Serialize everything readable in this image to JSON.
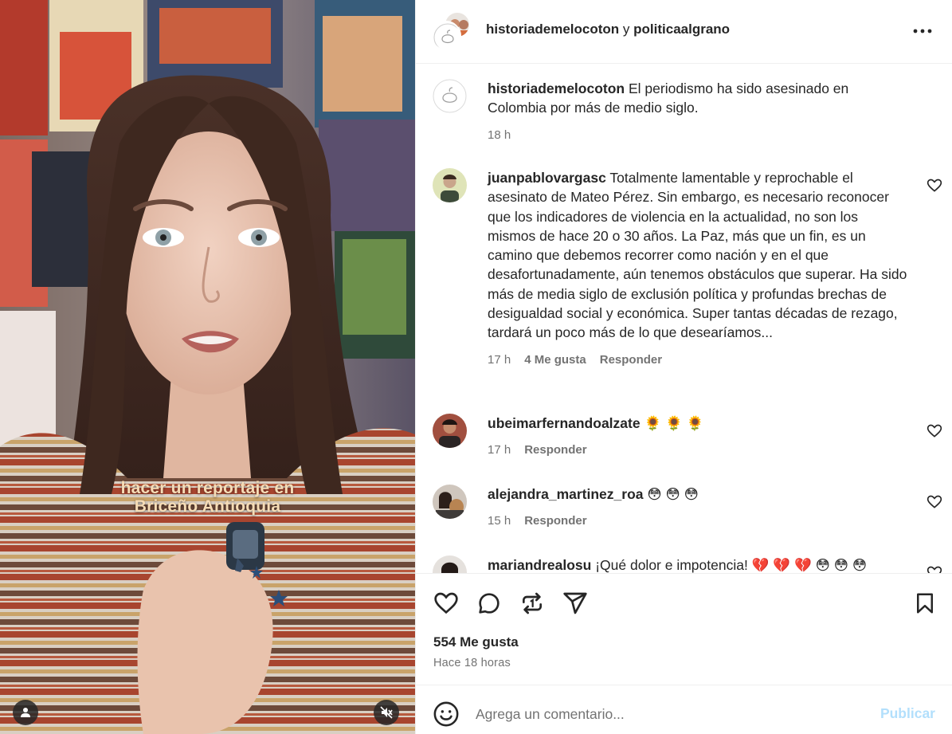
{
  "media": {
    "overlay_line1": "hacer un reportaje en",
    "overlay_line2": "Briceño Antioquia",
    "user_icon": "user-icon",
    "mute_icon": "speaker-muted-icon"
  },
  "header": {
    "author1": "historiademelocoton",
    "joiner": "y",
    "author2": "politicaalgrano",
    "more_icon": "more-horizontal-icon"
  },
  "caption": {
    "user": "historiademelocoton",
    "text": "El periodismo ha sido asesinado en Colombia por más de medio siglo.",
    "time": "18 h"
  },
  "comments": [
    {
      "user": "juanpablovargasc",
      "text": "Totalmente lamentable y reprochable el asesinato de Mateo Pérez. Sin embargo, es necesario reconocer que los indicadores de violencia en la actualidad, no son los mismos de hace 20 o 30 años. La Paz, más que un fin, es un camino que debemos recorrer como nación y en el que desafortunadamente, aún tenemos obstáculos que superar. Ha sido más de media siglo de exclusión política y profundas brechas de desigualdad social y económica. Super tantas décadas de rezago, tardará un poco más de lo que desearíamos...",
      "time": "17 h",
      "likes": "4 Me gusta",
      "reply": "Responder"
    },
    {
      "user": "ubeimarfernandoalzate",
      "text": "🌻 🌻 🌻",
      "time": "17 h",
      "reply": "Responder"
    },
    {
      "user": "alejandra_martinez_roa",
      "text": "😳 😳 😳",
      "time": "15 h",
      "reply": "Responder"
    },
    {
      "user": "mariandrealosu",
      "text": "¡Qué dolor e impotencia!  💔 💔 💔 😳 😳 😳"
    }
  ],
  "actions": {
    "like_icon": "heart-icon",
    "comment_icon": "comment-icon",
    "repost_icon": "repost-icon",
    "share_icon": "send-icon",
    "save_icon": "bookmark-icon",
    "likes_count": "554 Me gusta",
    "time_ago": "Hace 18 horas"
  },
  "add_comment": {
    "emoji_icon": "emoji-icon",
    "placeholder": "Agrega un comentario...",
    "publish": "Publicar"
  },
  "colors": {
    "publish_disabled": "#b2dffc",
    "secondary_text": "#737373",
    "primary_text": "#262626",
    "divider": "#efefef"
  }
}
